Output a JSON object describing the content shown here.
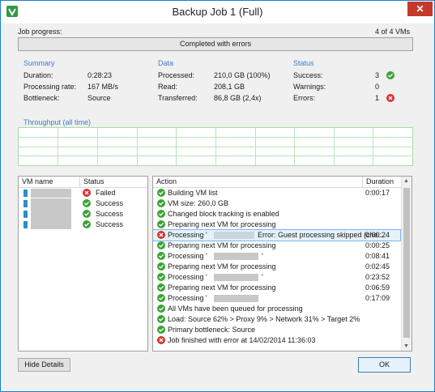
{
  "window": {
    "title": "Backup Job 1 (Full)",
    "close_glyph": "✕"
  },
  "job_progress": {
    "label": "Job progress:",
    "count": "4 of 4 VMs",
    "status_text": "Completed with errors"
  },
  "summary": {
    "title": "Summary",
    "duration_label": "Duration:",
    "duration": "0:28:23",
    "rate_label": "Processing rate:",
    "rate": "167 MB/s",
    "bottleneck_label": "Bottleneck:",
    "bottleneck": "Source"
  },
  "data_group": {
    "title": "Data",
    "processed_label": "Processed:",
    "processed": "210,0 GB (100%)",
    "read_label": "Read:",
    "read": "208,1 GB",
    "transferred_label": "Transferred:",
    "transferred": "86,8 GB (2,4x)"
  },
  "status_group": {
    "title": "Status",
    "success_label": "Success:",
    "success": "3",
    "warnings_label": "Warnings:",
    "warnings": "0",
    "errors_label": "Errors:",
    "errors": "1"
  },
  "throughput": {
    "title": "Throughput (all time)"
  },
  "vm_table": {
    "headers": {
      "name": "VM name",
      "status": "Status"
    },
    "rows": [
      {
        "status": "Failed",
        "icon": "error"
      },
      {
        "status": "Success",
        "icon": "success"
      },
      {
        "status": "Success",
        "icon": "success"
      },
      {
        "status": "Success",
        "icon": "success"
      }
    ]
  },
  "action_table": {
    "headers": {
      "action": "Action",
      "duration": "Duration"
    },
    "rows": [
      {
        "icon": "success",
        "text": "Building VM list",
        "duration": "0:00:17"
      },
      {
        "icon": "success",
        "text": "VM size: 260,0 GB",
        "duration": ""
      },
      {
        "icon": "success",
        "text": "Changed block tracking is enabled",
        "duration": ""
      },
      {
        "icon": "success",
        "text": "Preparing next VM for processing",
        "duration": ""
      },
      {
        "icon": "error",
        "text": "Processing '",
        "text2": "Error: Guest processing skipped (che...",
        "duration": "0:00:24",
        "selected": true
      },
      {
        "icon": "success",
        "text": "Preparing next VM for processing",
        "duration": "0:00:25"
      },
      {
        "icon": "success",
        "text": "Processing '",
        "text2": "'",
        "duration": "0:08:41"
      },
      {
        "icon": "success",
        "text": "Preparing next VM for processing",
        "duration": "0:02:45"
      },
      {
        "icon": "success",
        "text": "Processing '",
        "text2": "'",
        "duration": "0:23:52"
      },
      {
        "icon": "success",
        "text": "Preparing next VM for processing",
        "duration": "0:06:59"
      },
      {
        "icon": "success",
        "text": "Processing '",
        "text2": "",
        "duration": "0:17:09"
      },
      {
        "icon": "success",
        "text": "All VMs have been queued for processing",
        "duration": ""
      },
      {
        "icon": "success",
        "text": "Load: Source 62% > Proxy 9% > Network 31% > Target 2%",
        "duration": ""
      },
      {
        "icon": "success",
        "text": "Primary bottleneck: Source",
        "duration": ""
      },
      {
        "icon": "error",
        "text": "Job finished with error at 14/02/2014 11:36:03",
        "duration": ""
      }
    ]
  },
  "buttons": {
    "hide_details": "Hide Details",
    "ok": "OK"
  }
}
